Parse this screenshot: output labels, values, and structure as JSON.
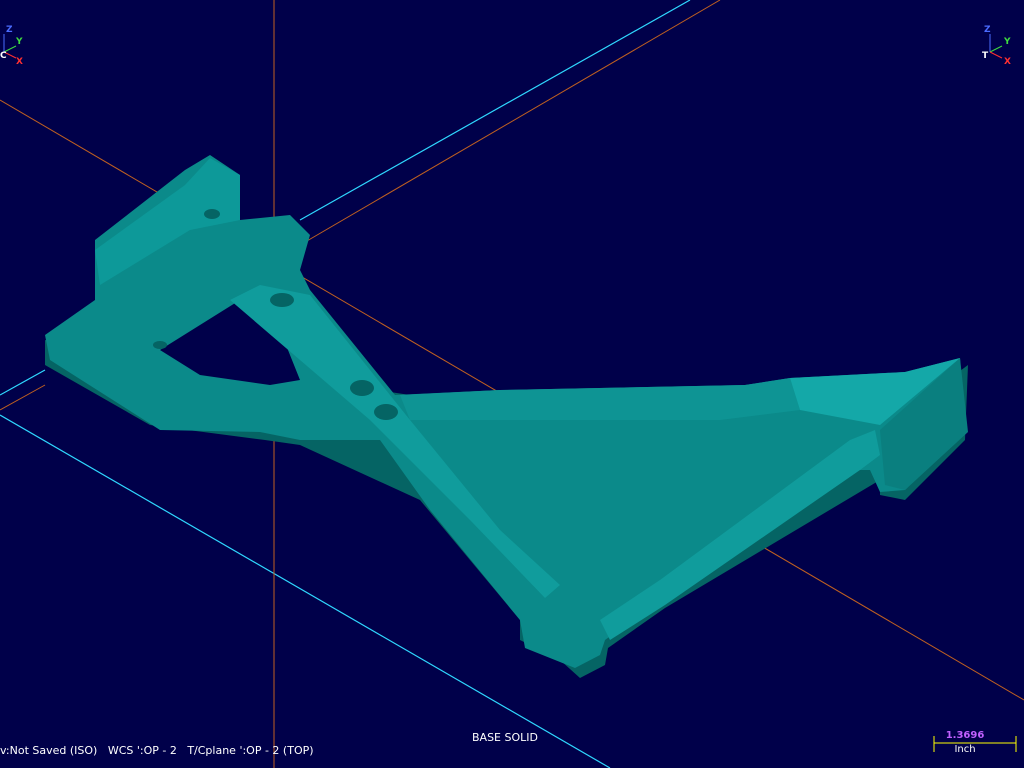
{
  "gnomon_left": {
    "labels": [
      "Z",
      "Y",
      "C",
      "X"
    ],
    "colors": [
      "#4a6bff",
      "#3fdc3f",
      "#ffffff",
      "#ff3030"
    ]
  },
  "gnomon_right": {
    "labels": [
      "Z",
      "Y",
      "T",
      "X"
    ],
    "colors": [
      "#4a6bff",
      "#3fdc3f",
      "#ffffff",
      "#ff3030"
    ]
  },
  "status": {
    "view_info": "v:Not Saved (ISO)   WCS ':OP - 2   T/Cplane ':OP - 2 (TOP)",
    "entity_label": "BASE SOLID"
  },
  "scale": {
    "value": "1.3696",
    "unit": "Inch",
    "value_color": "#c060ff",
    "bar_color": "#ffff00"
  },
  "colors": {
    "background": "#00004a",
    "solid": "#0b8a8a",
    "solid_dark": "#056464",
    "solid_light": "#18b3b3",
    "axis_cyan": "#2fd8ff",
    "axis_orange": "#c06020"
  }
}
